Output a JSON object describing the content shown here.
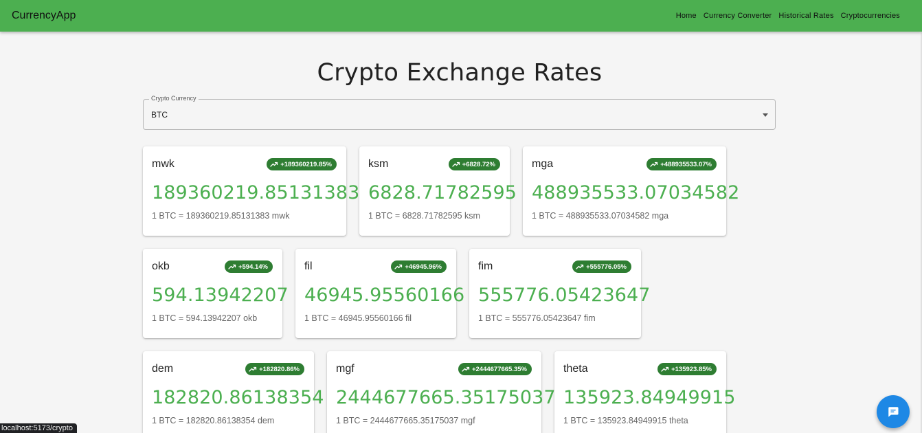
{
  "app": {
    "brand": "CurrencyApp"
  },
  "nav": [
    "Home",
    "Currency Converter",
    "Historical Rates",
    "Cryptocurrencies"
  ],
  "page": {
    "title": "Crypto Exchange Rates"
  },
  "select": {
    "label": "Crypto Currency",
    "value": "BTC"
  },
  "cards": [
    {
      "code": "mwk",
      "change": "+189360219.85%",
      "value": "189360219.85131383",
      "rate": "1 BTC = 189360219.85131383 mwk"
    },
    {
      "code": "ksm",
      "change": "+6828.72%",
      "value": "6828.71782595",
      "rate": "1 BTC = 6828.71782595 ksm"
    },
    {
      "code": "mga",
      "change": "+488935533.07%",
      "value": "488935533.07034582",
      "rate": "1 BTC = 488935533.07034582 mga"
    },
    {
      "code": "okb",
      "change": "+594.14%",
      "value": "594.13942207",
      "rate": "1 BTC = 594.13942207 okb"
    },
    {
      "code": "fil",
      "change": "+46945.96%",
      "value": "46945.95560166",
      "rate": "1 BTC = 46945.95560166 fil"
    },
    {
      "code": "fim",
      "change": "+555776.05%",
      "value": "555776.05423647",
      "rate": "1 BTC = 555776.05423647 fim"
    },
    {
      "code": "dem",
      "change": "+182820.86%",
      "value": "182820.86138354",
      "rate": "1 BTC = 182820.86138354 dem"
    },
    {
      "code": "mgf",
      "change": "+2444677665.35%",
      "value": "2444677665.35175037",
      "rate": "1 BTC = 2444677665.35175037 mgf"
    },
    {
      "code": "theta",
      "change": "+135923.85%",
      "value": "135923.84949915",
      "rate": "1 BTC = 135923.84949915 theta"
    }
  ],
  "status_url": "localhost:5173/crypto",
  "colors": {
    "appbar": "#4caf50",
    "badge": "#2e7d32",
    "value": "#4caf50",
    "fab": "#1e88e5"
  },
  "icons": {
    "badge": "trending-up-icon",
    "fab": "chat-icon",
    "select": "arrow-drop-down-icon"
  }
}
